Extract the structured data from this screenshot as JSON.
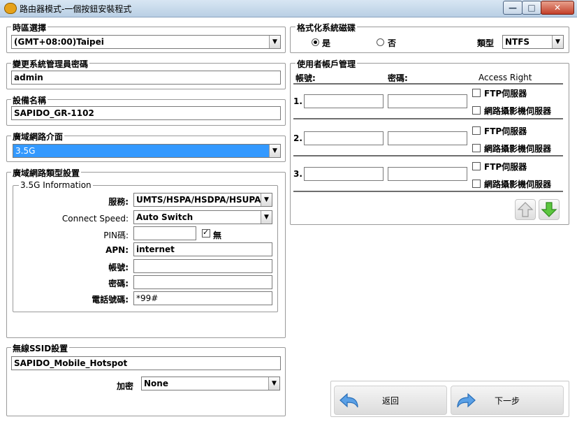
{
  "window": {
    "title": "路由器模式-一個按鈕安裝程式",
    "min_symbol": "—",
    "max_symbol": "□",
    "close_symbol": "✕"
  },
  "timezone": {
    "title": "時區選擇",
    "value": "(GMT+08:00)Taipei"
  },
  "admin_password": {
    "title": "變更系統管理員密碼",
    "value": "admin"
  },
  "device_name": {
    "title": "設備名稱",
    "value": "SAPIDO_GR-1102"
  },
  "wan_interface": {
    "title": "廣域網路介面",
    "value": "3.5G"
  },
  "wan_type": {
    "title": "廣域網路類型設置",
    "group_title": "3.5G Information",
    "service_label": "服務:",
    "service_value": "UMTS/HSPA/HSDPA/HSUPA",
    "connect_speed_label": "Connect Speed:",
    "connect_speed_value": "Auto Switch",
    "pin_label": "PIN碼:",
    "pin_value": "",
    "none_label": "無",
    "none_checked": true,
    "apn_label": "APN:",
    "apn_value": "internet",
    "account_label": "帳號:",
    "account_value": "",
    "password_label": "密碼:",
    "password_value": "",
    "phone_label": "電話號碼:",
    "phone_value": "*99#"
  },
  "wireless": {
    "title": "無線SSID設置",
    "ssid": "SAPIDO_Mobile_Hotspot",
    "encrypt_label": "加密",
    "encrypt_value": "None"
  },
  "format": {
    "title": "格式化系統磁碟",
    "yes_label": "是",
    "no_label": "否",
    "selected": "yes",
    "type_label": "類型",
    "type_value": "NTFS"
  },
  "accounts": {
    "title": "使用者帳戶管理",
    "col_account": "帳號:",
    "col_password": "密碼:",
    "col_access": "Access Right",
    "ftp_label": "FTP伺服器",
    "camera_label": "網路攝影機伺服器",
    "rows": [
      {
        "num": "1.",
        "account": "",
        "password": ""
      },
      {
        "num": "2.",
        "account": "",
        "password": ""
      },
      {
        "num": "3.",
        "account": "",
        "password": ""
      }
    ]
  },
  "nav": {
    "back_label": "返回",
    "next_label": "下一步"
  },
  "colors": {
    "selection": "#3399ff",
    "titlebar": "#c9daee",
    "close": "#c84a32",
    "nav_green": "#4fb83a",
    "nav_blue": "#2f7ed8"
  }
}
